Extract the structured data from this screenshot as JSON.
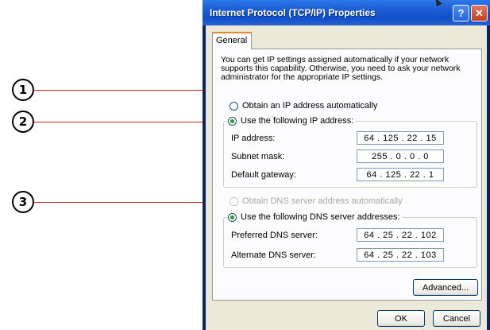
{
  "callouts": [
    "1",
    "2",
    "3"
  ],
  "dialog": {
    "title": "Internet Protocol (TCP/IP) Properties",
    "help_glyph": "?",
    "close_glyph": "✕",
    "tab_label": "General",
    "description": "You can get IP settings assigned automatically if your network supports this capability. Otherwise, you need to ask your network administrator for the appropriate IP settings.",
    "ip_auto_label": "Obtain an IP address automatically",
    "ip_manual_label": "Use the following IP address:",
    "ip_fields": [
      {
        "label": "IP address:",
        "value": "64 . 125 . 22 . 15"
      },
      {
        "label": "Subnet mask:",
        "value": "255 .  0  .  0  .  0"
      },
      {
        "label": "Default gateway:",
        "value": "64 . 125 . 22 .  1"
      }
    ],
    "dns_auto_label": "Obtain DNS server address automatically",
    "dns_manual_label": "Use the following DNS server addresses:",
    "dns_fields": [
      {
        "label": "Preferred DNS server:",
        "value": "64 . 25 . 22 . 102"
      },
      {
        "label": "Alternate DNS server:",
        "value": "64 . 25 . 22 . 103"
      }
    ],
    "advanced_button": "Advanced...",
    "ok_button": "OK",
    "cancel_button": "Cancel",
    "selected_ip_option": "manual",
    "selected_dns_option": "manual",
    "colors": {
      "title_bar": "#1d5fd6",
      "dialog_face": "#ece9d8",
      "callout_line": "#c62828",
      "radio_dot": "#21a121"
    }
  }
}
